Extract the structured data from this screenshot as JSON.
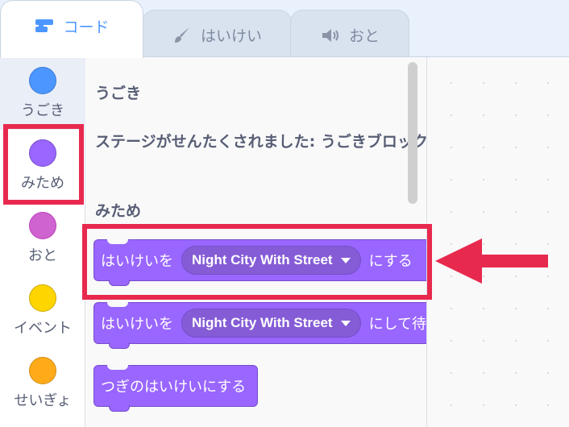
{
  "tabs": [
    {
      "label": "コード",
      "icon": "code-icon",
      "active": true
    },
    {
      "label": "はいけい",
      "icon": "brush-icon",
      "active": false
    },
    {
      "label": "おと",
      "icon": "speaker-icon",
      "active": false
    }
  ],
  "categories": [
    {
      "label": "うごき",
      "color": "#4c97ff"
    },
    {
      "label": "みため",
      "color": "#9966ff"
    },
    {
      "label": "おと",
      "color": "#cf63cf"
    },
    {
      "label": "イベント",
      "color": "#ffd500"
    },
    {
      "label": "せいぎょ",
      "color": "#ffab19"
    }
  ],
  "palette": {
    "motion_heading": "うごき",
    "motion_note": "ステージがせんたくされました: うごきブロックはありません",
    "looks_heading": "みため",
    "blocks": [
      {
        "prefix": "はいけいを",
        "dropdown": "Night City With Street",
        "suffix": "にする"
      },
      {
        "prefix": "はいけいを",
        "dropdown": "Night City With Street",
        "suffix": "にして待つ"
      },
      {
        "text": "つぎのはいけいにする"
      }
    ]
  },
  "colors": {
    "looks": "#9966ff",
    "highlight": "#e8294e",
    "accent": "#4c97ff"
  }
}
